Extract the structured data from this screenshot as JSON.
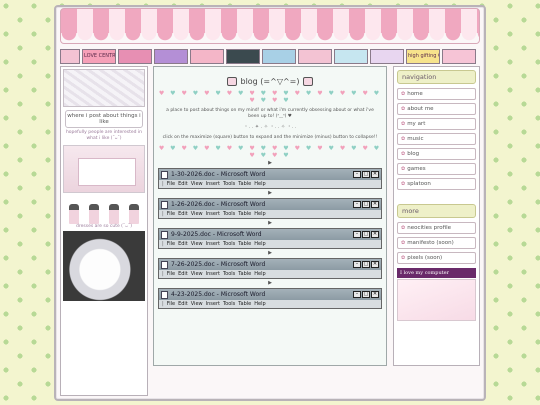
{
  "header": {
    "button_strip": [
      {
        "label": "",
        "color": "#f3c3d3"
      },
      {
        "label": "LOVE CENTRAL",
        "color": "#f6a0b8"
      },
      {
        "label": "",
        "color": "#e78fb3"
      },
      {
        "label": "",
        "color": "#b48fd6"
      },
      {
        "label": "",
        "color": "#f4b6c8"
      },
      {
        "label": "",
        "color": "#3b4a4f"
      },
      {
        "label": "",
        "color": "#a8d0e6"
      },
      {
        "label": "",
        "color": "#f3c3d3"
      },
      {
        "label": "",
        "color": "#c6e6f0"
      },
      {
        "label": "",
        "color": "#e8d6f0"
      },
      {
        "label": "high gifting CSS apply",
        "color": "#f7e38c"
      },
      {
        "label": "",
        "color": "#f6c4d6"
      }
    ]
  },
  "left": {
    "recommend_title": "where i post about things i like",
    "recommend_sub": "hopefully people are interested in what i like (˘ᴗ˘)",
    "dresses_caption": "dresses are so cute (˘ᴗ˘)"
  },
  "main": {
    "title": "blog (=^▽^=)",
    "hearts_top": "♥ ♥ ♥ ♥ ♥ ♥ ♥ ♥ ♥ ♥ ♥ ♥ ♥ ♥ ♥ ♥ ♥ ♥ ♥ ♥ ♥ ♥ ♥ ♥",
    "intro": "a place to post about things on my mind! or what i'm currently obsessing about or what i've been up to! (ᐢ‿ᐢ) ♥",
    "separator": "・. . ✦ . ✧ ・. . ✧ ・. .",
    "hint": "click on the maximize (square) button to expand and the minimize (minus) button to collapse!!",
    "hearts_bottom": "♥ ♥ ♥ ♥ ♥ ♥ ♥ ♥ ♥ ♥ ♥ ♥ ♥ ♥ ♥ ♥ ♥ ♥ ♥ ♥ ♥ ♥ ♥ ♥",
    "arrow": "▶",
    "heart_colors": [
      "#f2a1bb",
      "#8fd0c4"
    ],
    "menu": [
      "|  ",
      "File",
      "Edit",
      "View",
      "Insert",
      "Tools",
      "Table",
      "Help"
    ],
    "posts": [
      {
        "title": "1-30-2026.doc - Microsoft Word"
      },
      {
        "title": "1-26-2026.doc - Microsoft Word"
      },
      {
        "title": "9-9-2025.doc - Microsoft Word"
      },
      {
        "title": "7-26-2025.doc - Microsoft Word"
      },
      {
        "title": "4-23-2025.doc - Microsoft Word"
      }
    ],
    "window_buttons": {
      "minimize": "–",
      "maximize": "□",
      "close": "✕"
    }
  },
  "right": {
    "nav_title": "navigation",
    "nav_items": [
      {
        "label": "home",
        "icon": "home-icon"
      },
      {
        "label": "about me",
        "icon": "user-icon"
      },
      {
        "label": "my art",
        "icon": "brush-icon"
      },
      {
        "label": "music",
        "icon": "music-icon"
      },
      {
        "label": "blog",
        "icon": "pen-icon"
      },
      {
        "label": "games",
        "icon": "game-icon"
      },
      {
        "label": "splatoon",
        "icon": "squid-icon"
      }
    ],
    "more_title": "more",
    "more_items": [
      {
        "label": "neocities profile",
        "icon": "profile-icon"
      },
      {
        "label": "manifesto (soon)",
        "icon": "scroll-icon"
      },
      {
        "label": "pixels (soon)",
        "icon": "pixel-icon"
      }
    ],
    "sticker_text": "I love my computer"
  }
}
